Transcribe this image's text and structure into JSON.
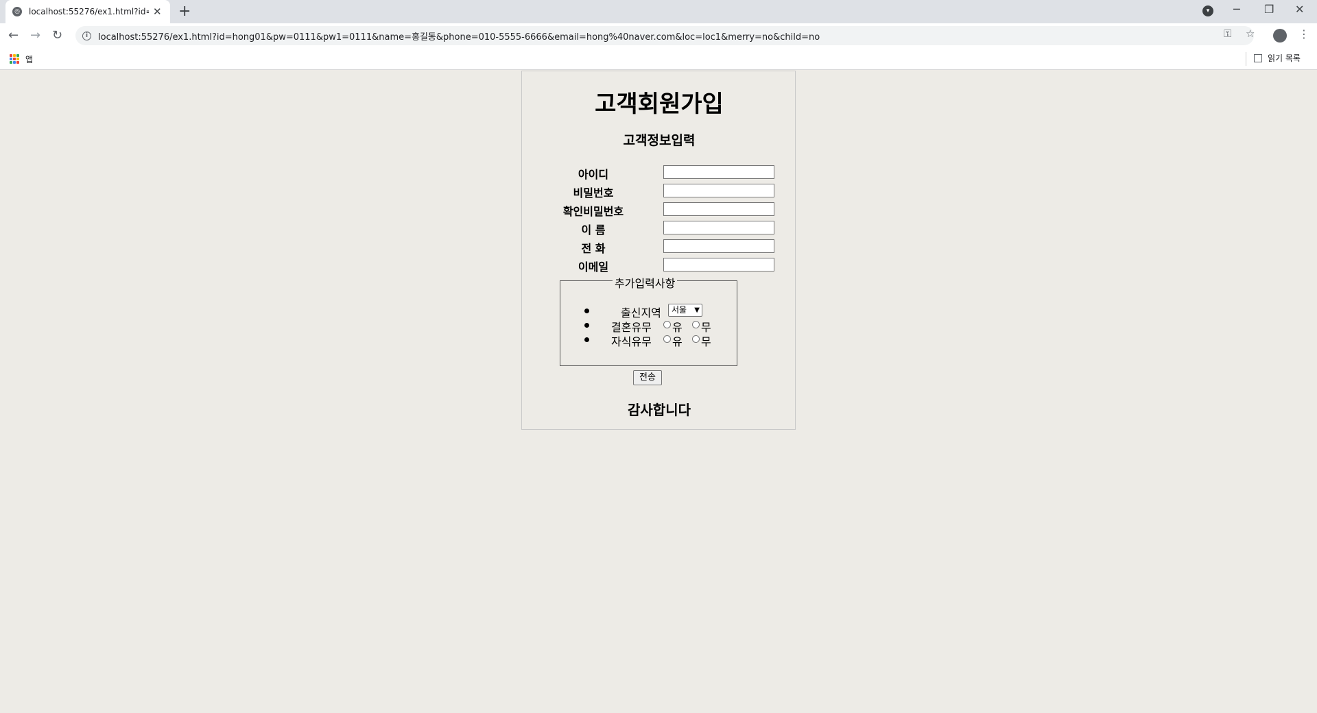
{
  "browser": {
    "tab_title": "localhost:55276/ex1.html?id=ho",
    "address": "localhost:55276/ex1.html?id=hong01&pw=0111&pw1=0111&name=홍길동&phone=010-5555-6666&email=hong%40naver.com&loc=loc1&merry=no&child=no",
    "apps_label": "앱",
    "reading_list_label": "읽기 목록"
  },
  "page": {
    "title": "고객회원가입",
    "subtitle": "고객정보입력",
    "fields": [
      {
        "label": "아이디",
        "value": ""
      },
      {
        "label": "비밀번호",
        "value": ""
      },
      {
        "label": "확인비밀번호",
        "value": ""
      },
      {
        "label": "이 름",
        "value": ""
      },
      {
        "label": "전 화",
        "value": ""
      },
      {
        "label": "이메일",
        "value": ""
      }
    ],
    "extra": {
      "legend": "추가입력사항",
      "region_label": "출신지역",
      "region_selected": "서울",
      "marriage_label": "결혼유무",
      "child_label": "자식유무",
      "yes_label": "유",
      "no_label": "무"
    },
    "submit_label": "전송",
    "footer": "감사합니다"
  }
}
